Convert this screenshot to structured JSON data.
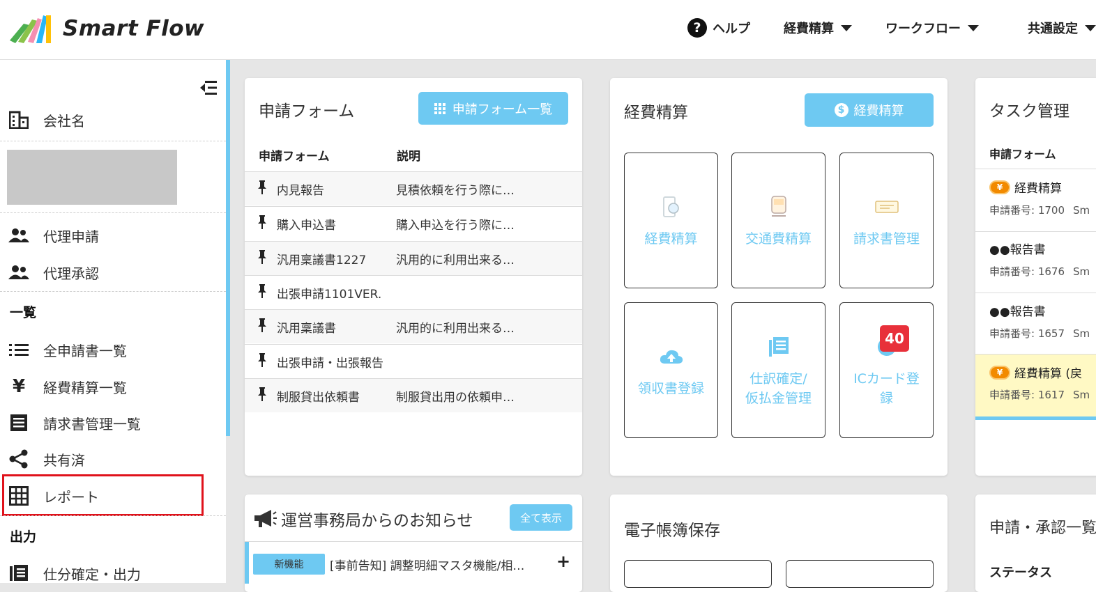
{
  "header": {
    "logo_text": "Smart Flow",
    "nav": [
      {
        "label": "ヘルプ"
      },
      {
        "label": "経費精算"
      },
      {
        "label": "ワークフロー"
      },
      {
        "label": "共通設定"
      }
    ]
  },
  "sidebar": {
    "company_label": "会社名",
    "proxy_apply": "代理申請",
    "proxy_approve": "代理承認",
    "list_heading": "一覧",
    "list_items": [
      {
        "label": "全申請書一覧",
        "icon": "list-icon"
      },
      {
        "label": "経費精算一覧",
        "icon": "yen-icon"
      },
      {
        "label": "請求書管理一覧",
        "icon": "invoice-icon"
      },
      {
        "label": "共有済",
        "icon": "share-icon"
      },
      {
        "label": "レポート",
        "icon": "grid-icon"
      }
    ],
    "output_heading": "出力",
    "output_item": "仕分確定・出力"
  },
  "forms_card": {
    "title": "申請フォーム",
    "button": "申請フォーム一覧",
    "col_form": "申請フォーム",
    "col_desc": "説明",
    "rows": [
      {
        "name": "内見報告",
        "desc": "見積依頼を行う際に…"
      },
      {
        "name": "購入申込書",
        "desc": "購入申込を行う際に…"
      },
      {
        "name": "汎用稟議書1227",
        "desc": "汎用的に利用出来る…"
      },
      {
        "name": "出張申請1101VER.",
        "desc": ""
      },
      {
        "name": "汎用稟議書",
        "desc": "汎用的に利用出来る…"
      },
      {
        "name": "出張申請・出張報告",
        "desc": ""
      },
      {
        "name": "制服貸出依頼書",
        "desc": "制服貸出用の依頼申…"
      }
    ]
  },
  "expense_card": {
    "title": "経費精算",
    "button": "経費精算",
    "tiles": [
      {
        "label": "経費精算"
      },
      {
        "label": "交通費精算"
      },
      {
        "label": "請求書管理"
      },
      {
        "label": "領収書登録"
      },
      {
        "label": "仕訳確定/\n仮払金管理"
      },
      {
        "label": "ICカード登\n録"
      }
    ],
    "badge": "40"
  },
  "task_card": {
    "title": "タスク管理",
    "col": "申請フォーム",
    "tasks": [
      {
        "title": "経費精算",
        "num": "申請番号: 1700",
        "suffix": "Sm"
      },
      {
        "title": "●●報告書",
        "num": "申請番号: 1676",
        "suffix": "Sm"
      },
      {
        "title": "●●報告書",
        "num": "申請番号: 1657",
        "suffix": "Sm"
      },
      {
        "title": "経費精算 (戻",
        "num": "申請番号: 1617",
        "suffix": "Sm"
      }
    ],
    "yen_mark": "¥"
  },
  "notice_card": {
    "title": "運営事務局からのお知らせ",
    "button": "全て表示",
    "tag": "新機能",
    "text": "[事前告知] 調整明細マスタ機能/相…",
    "expand": "+"
  },
  "ledger_card": {
    "title": "電子帳簿保存"
  },
  "approval_card": {
    "title": "申請・承認一覧",
    "col": "ステータス"
  }
}
